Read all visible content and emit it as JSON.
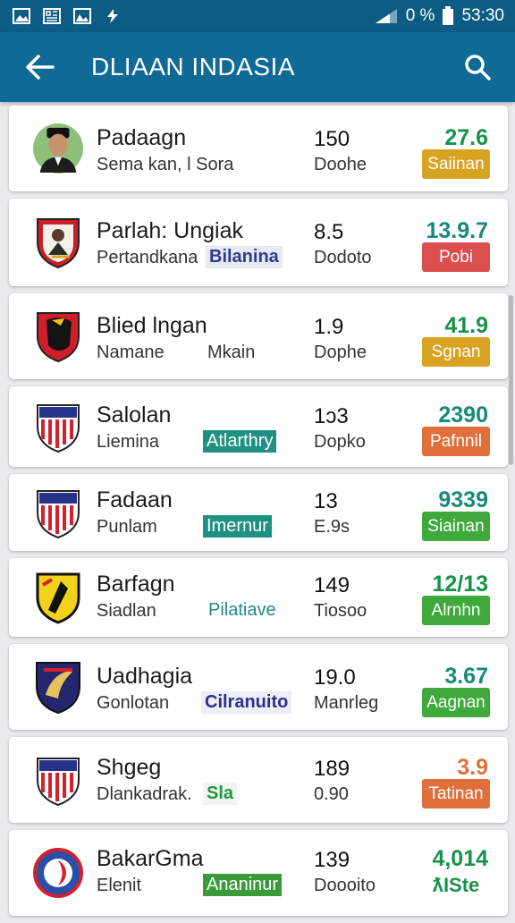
{
  "status_bar": {
    "battery_text": "0 %",
    "time": "53:30"
  },
  "app_bar": {
    "title": "DLIAAN INDASIA"
  },
  "colors": {
    "app_bar": "#0f6a96",
    "value_green": "#17924a",
    "value_teal": "#168a78"
  },
  "rows": [
    {
      "name": "Padaagn",
      "sub": "Sema kan, l Sora",
      "tag": "",
      "stat": "150",
      "stat_sub": "Doohe",
      "value": "27.6",
      "badge": "Saiinan",
      "badge_color": "#d9a322",
      "badge_text": "#ffffff",
      "avatar": "person-photo"
    },
    {
      "name": "Parlah: Ungiak",
      "sub": "Pertandkana",
      "tag": "Bilanina",
      "stat": "8.5",
      "stat_sub": "Dodoto",
      "value": "13.9.7",
      "badge": "Pobi",
      "badge_color": "#dc4f4f",
      "badge_text": "#ffffff",
      "avatar": "club-crest-red"
    },
    {
      "name": "Blied lngan",
      "sub": "Namane",
      "sub2": "Mkain",
      "tag": "",
      "stat": "1.9",
      "stat_sub": "Dophe",
      "value": "41.9",
      "badge": "Sgnan",
      "badge_color": "#d9a322",
      "badge_text": "#ffffff",
      "avatar": "club-crest-black"
    },
    {
      "name": "Salolan",
      "sub": "Liemina",
      "tag": "Atlarthry",
      "stat": "1ɔ3",
      "stat_sub": "Dopko",
      "value": "2390",
      "badge": "Pafnnil",
      "badge_color": "#e16f3c",
      "badge_text": "#ffffff",
      "avatar": "club-crest-stripes"
    },
    {
      "name": "Fadaan",
      "sub": "Punlam",
      "tag": "Imernur",
      "stat": "13",
      "stat_sub": "E.9s",
      "value": "9339",
      "badge": "Siainan",
      "badge_color": "#3fa93c",
      "badge_text": "#ffffff",
      "avatar": "club-crest-stripes"
    },
    {
      "name": "Barfagn",
      "sub": "Siadlan",
      "tag": "Pilatiave",
      "stat": "149",
      "stat_sub": "Tiosoo",
      "value": "12/13",
      "badge": "Alrnhn",
      "badge_color": "#3fa93c",
      "badge_text": "#ffffff",
      "avatar": "club-crest-yellow"
    },
    {
      "name": "Uadhagia",
      "sub": "Gonlotan",
      "tag": "Cilranuito",
      "stat": "19.0",
      "stat_sub": "Manrleg",
      "value": "3.67",
      "badge": "Aagnan",
      "badge_color": "#3fa93c",
      "badge_text": "#ffffff",
      "avatar": "club-crest-navy"
    },
    {
      "name": "Shgeg",
      "sub": "Dlankadrak.",
      "tag": "Sla",
      "stat": "189",
      "stat_sub": "0.90",
      "value": "3.9",
      "badge": "Tatinan",
      "badge_color": "#e16f3c",
      "badge_text": "#ffffff",
      "avatar": "club-crest-stripes"
    },
    {
      "name": "BakarGma",
      "sub": "Elenit",
      "tag": "Ananinur",
      "stat": "139",
      "stat_sub": "Doooito",
      "value": "4,014",
      "badge": "ƛISte",
      "badge_color": "transparent",
      "badge_text": "#17924a",
      "avatar": "club-crest-blue"
    }
  ]
}
